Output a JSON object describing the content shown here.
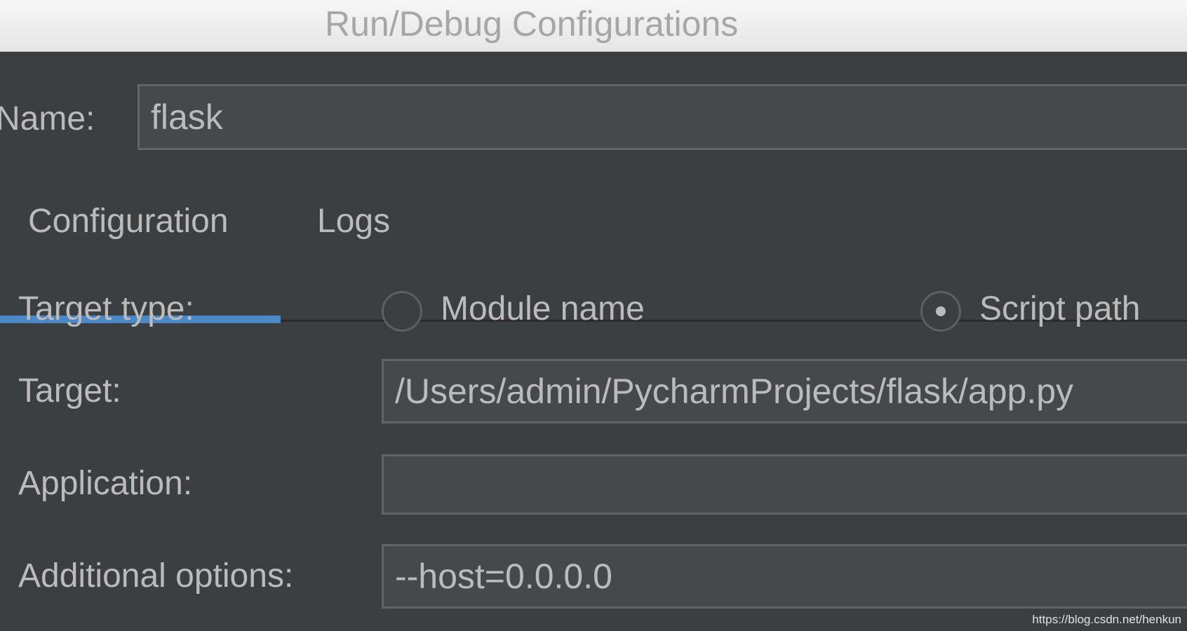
{
  "window": {
    "title": "Run/Debug Configurations"
  },
  "name": {
    "label": "Name:",
    "value": "flask"
  },
  "tabs": [
    {
      "label": "Configuration",
      "active": true
    },
    {
      "label": "Logs",
      "active": false
    }
  ],
  "target_type": {
    "label": "Target type:",
    "options": [
      {
        "label": "Module name",
        "selected": false
      },
      {
        "label": "Script path",
        "selected": true
      }
    ]
  },
  "target": {
    "label": "Target:",
    "value": "/Users/admin/PycharmProjects/flask/app.py"
  },
  "application": {
    "label": "Application:",
    "value": ""
  },
  "additional_options": {
    "label": "Additional options:",
    "value": "--host=0.0.0.0"
  },
  "watermark": "https://blog.csdn.net/henkun",
  "colors": {
    "background": "#3c3f41",
    "field_background": "#45494a",
    "text": "#bbbbbb",
    "accent": "#4a88c7"
  }
}
